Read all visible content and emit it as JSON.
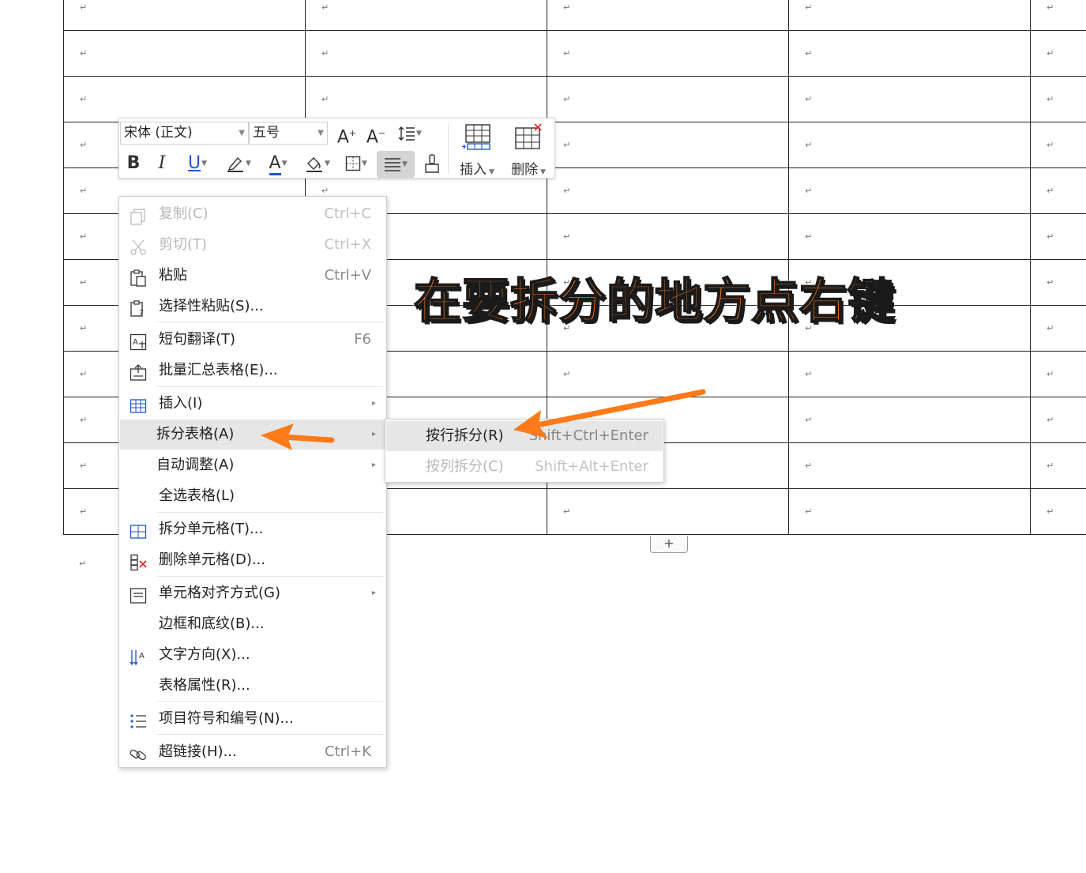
{
  "document": {
    "paragraph_mark": "↵",
    "rows": 12,
    "columns": 5,
    "add_row_label": "+"
  },
  "toolbar": {
    "font_name": "宋体 (正文)",
    "font_size": "五号",
    "increase_font": "A",
    "decrease_font": "A",
    "line_spacing_icon": "line-spacing-icon",
    "bold": "B",
    "italic": "I",
    "underline": "U",
    "font_color": "A",
    "insert_label": "插入",
    "delete_label": "删除",
    "accent_red": "#e0201b",
    "accent_blue": "#1e56d6"
  },
  "context_menu": {
    "items": [
      {
        "label": "复制(C)",
        "shortcut": "Ctrl+C",
        "icon": "copy-icon",
        "disabled": true
      },
      {
        "label": "剪切(T)",
        "shortcut": "Ctrl+X",
        "icon": "cut-icon",
        "disabled": true
      },
      {
        "label": "粘贴",
        "shortcut": "Ctrl+V",
        "icon": "paste-icon"
      },
      {
        "label": "选择性粘贴(S)...",
        "shortcut": "",
        "icon": "paste-special-icon"
      },
      {
        "label": "短句翻译(T)",
        "shortcut": "F6",
        "icon": "translate-icon"
      },
      {
        "label": "批量汇总表格(E)...",
        "shortcut": "",
        "icon": "batch-summary-icon"
      },
      {
        "label": "插入(I)",
        "shortcut": "",
        "icon": "table-insert-icon",
        "submenu": true
      },
      {
        "label": "拆分表格(A)",
        "shortcut": "",
        "icon": "",
        "submenu": true,
        "highlight": true
      },
      {
        "label": "自动调整(A)",
        "shortcut": "",
        "icon": "",
        "submenu": true
      },
      {
        "label": "全选表格(L)",
        "shortcut": "",
        "icon": ""
      },
      {
        "label": "拆分单元格(T)...",
        "shortcut": "",
        "icon": "split-cells-icon"
      },
      {
        "label": "删除单元格(D)...",
        "shortcut": "",
        "icon": "delete-cells-icon"
      },
      {
        "label": "单元格对齐方式(G)",
        "shortcut": "",
        "icon": "cell-align-icon",
        "submenu": true
      },
      {
        "label": "边框和底纹(B)...",
        "shortcut": "",
        "icon": ""
      },
      {
        "label": "文字方向(X)...",
        "shortcut": "",
        "icon": "text-direction-icon"
      },
      {
        "label": "表格属性(R)...",
        "shortcut": "",
        "icon": ""
      },
      {
        "label": "项目符号和编号(N)...",
        "shortcut": "",
        "icon": "bullet-list-icon"
      },
      {
        "label": "超链接(H)...",
        "shortcut": "Ctrl+K",
        "icon": "hyperlink-icon"
      }
    ]
  },
  "split_submenu": {
    "items": [
      {
        "label": "按行拆分(R)",
        "shortcut": "Shift+Ctrl+Enter",
        "highlight": true
      },
      {
        "label": "按列拆分(C)",
        "shortcut": "Shift+Alt+Enter",
        "disabled": true
      }
    ]
  },
  "annotation": {
    "callout_text": "在要拆分的地方点右键",
    "arrow_color": "#ff7a1a"
  }
}
